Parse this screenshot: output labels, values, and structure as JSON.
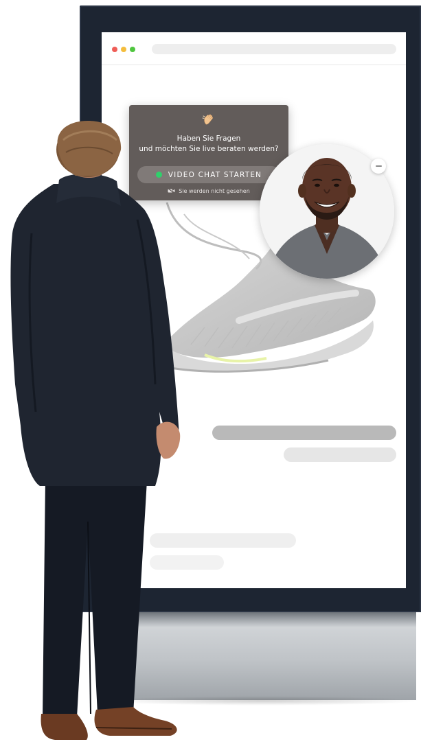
{
  "browser": {
    "window_controls": [
      "red-dot",
      "yellow-dot",
      "green-dot"
    ],
    "address_bar_text": ""
  },
  "chat_popup": {
    "icon": "waving-hand-icon",
    "line1": "Haben Sie Fragen",
    "line2": "und möchten Sie live beraten werden?",
    "button_label": "VIDEO CHAT STARTEN",
    "button_status_color": "#2fd06b",
    "privacy_icon": "camera-off-icon",
    "privacy_note": "Sie werden nicht gesehen"
  },
  "agent_avatar": {
    "minimize_icon": "minus-icon"
  },
  "colors": {
    "popup_background": "#625c5a",
    "button_background": "#807a78",
    "kiosk_frame": "#1d2532"
  }
}
